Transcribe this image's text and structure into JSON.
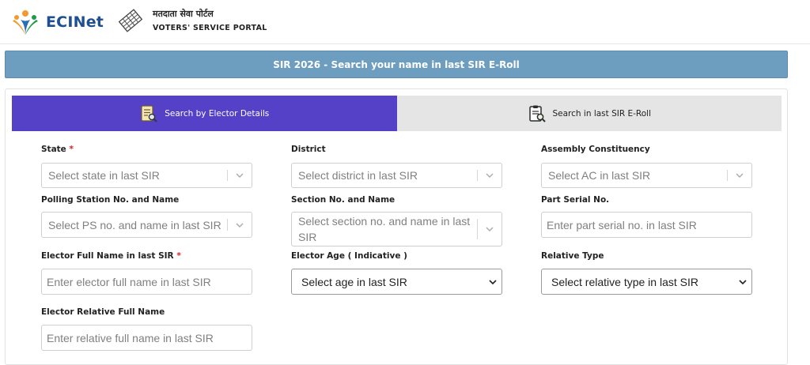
{
  "header": {
    "logo_text": "ECINet",
    "portal_hindi": "मतदाता सेवा पोर्टल",
    "portal_english": "VOTERS' SERVICE PORTAL"
  },
  "banner": {
    "title": "SIR 2026 - Search your name in last SIR E-Roll"
  },
  "tabs": [
    {
      "label": "Search by Elector Details",
      "active": true,
      "icon": "document-search-icon"
    },
    {
      "label": "Search in last SIR E-Roll",
      "active": false,
      "icon": "clipboard-search-icon"
    }
  ],
  "form": {
    "state": {
      "label": "State",
      "required_mark": "*",
      "placeholder": "Select state in last SIR"
    },
    "district": {
      "label": "District",
      "placeholder": "Select district in last SIR"
    },
    "assembly": {
      "label": "Assembly Constituency",
      "placeholder": "Select AC in last SIR"
    },
    "polling_station": {
      "label": "Polling Station No. and Name",
      "placeholder": "Select PS no. and name in last SIR"
    },
    "section": {
      "label": "Section No. and Name",
      "placeholder": "Select section no. and name in last SIR"
    },
    "part_serial": {
      "label": "Part Serial No.",
      "placeholder": "Enter part serial no. in last SIR"
    },
    "elector_name": {
      "label": "Elector Full Name in last SIR",
      "required_mark": "*",
      "placeholder": "Enter elector full name in last SIR"
    },
    "elector_age": {
      "label": "Elector Age ( Indicative )",
      "selected": "Select age in last SIR"
    },
    "relative_type": {
      "label": "Relative Type",
      "selected": "Select relative type in last SIR"
    },
    "relative_name": {
      "label": "Elector Relative Full Name",
      "placeholder": "Enter relative full name in last SIR"
    }
  },
  "colors": {
    "banner": "#6d9ebf",
    "active_tab": "#5441c8",
    "inactive_tab": "#e5e5e5",
    "required": "#e02020"
  }
}
